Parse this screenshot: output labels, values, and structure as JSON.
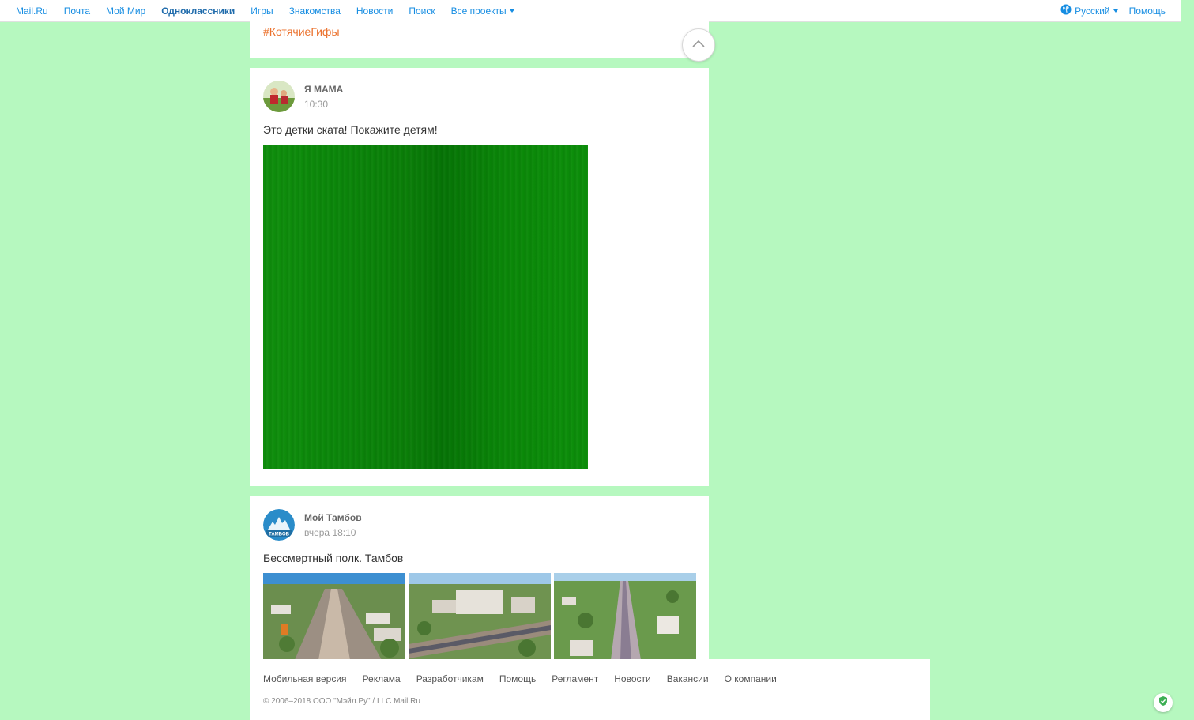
{
  "topbar": {
    "links": [
      "Mail.Ru",
      "Почта",
      "Мой Мир",
      "Одноклассники",
      "Игры",
      "Знакомства",
      "Новости",
      "Поиск",
      "Все проекты"
    ],
    "language": "Русский",
    "help": "Помощь"
  },
  "previous_post": {
    "hashtag": "#КотячиеГифы"
  },
  "posts": [
    {
      "author": "Я МАМА",
      "time": "10:30",
      "text": "Это детки ската! Покажите детям!"
    },
    {
      "author": "Мой Тамбов",
      "time": "вчера 18:10",
      "text": "Бессмертный полк. Тамбов",
      "avatar_label": "ТАМБОВ"
    }
  ],
  "footer": {
    "links": [
      "Мобильная версия",
      "Реклама",
      "Разработчикам",
      "Помощь",
      "Регламент",
      "Новости",
      "Вакансии",
      "О компании"
    ],
    "copyright": "© 2006–2018 ООО \"Мэйл.Ру\" / LLC Mail.Ru"
  },
  "colors": {
    "background": "#b6f8bf",
    "link": "#168de2",
    "hashtag": "#eb722e",
    "media_green": "#0a8808"
  },
  "icons": [
    "globe-icon",
    "chevron-up-icon",
    "shield-icon",
    "caret-down-icon"
  ]
}
